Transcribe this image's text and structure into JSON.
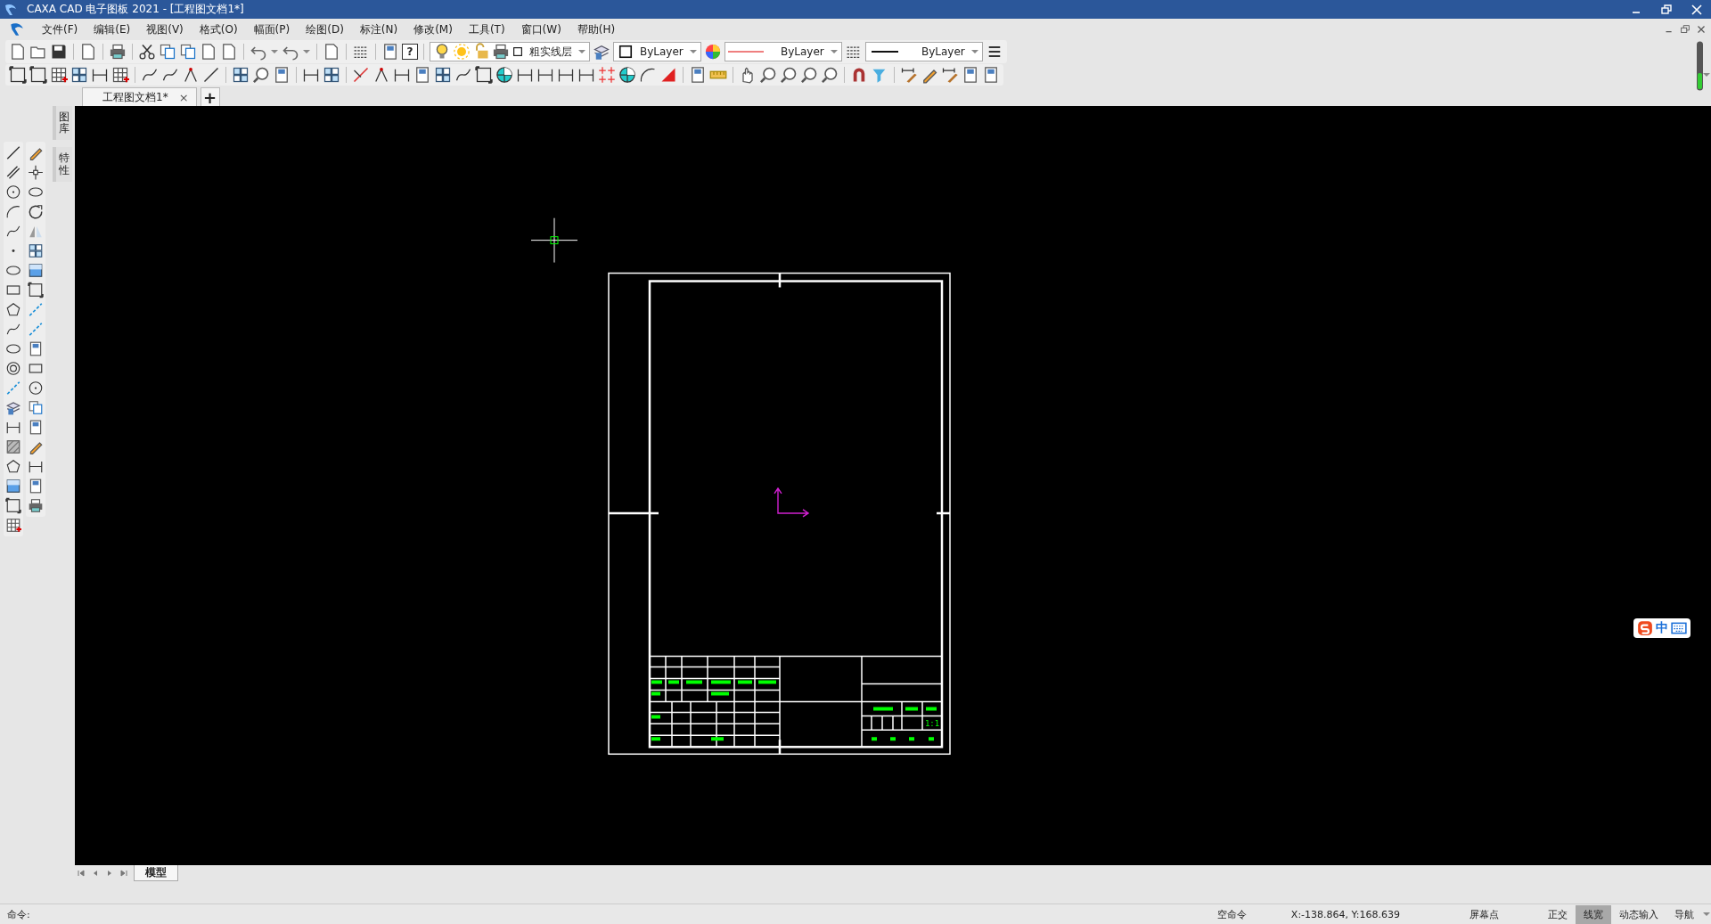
{
  "window": {
    "title": "CAXA CAD 电子图板 2021 - [工程图文档1*]"
  },
  "menu": [
    "文件(F)",
    "编辑(E)",
    "视图(V)",
    "格式(O)",
    "幅面(P)",
    "绘图(D)",
    "标注(N)",
    "修改(M)",
    "工具(T)",
    "窗口(W)",
    "帮助(H)"
  ],
  "toolbar": {
    "help_glyph": "?",
    "layer": "粗实线层",
    "color_mode": "ByLayer",
    "linetype": "ByLayer",
    "lineweight": "ByLayer"
  },
  "document_tabs": [
    {
      "label": "工程图文档1*",
      "selected": true,
      "close": "×"
    }
  ],
  "new_tab": "+",
  "side_panels": [
    "图库",
    "特性"
  ],
  "title_block": {
    "scale": "1:1"
  },
  "ime": {
    "label": "中"
  },
  "sheet_tabs": [
    {
      "label": "模型",
      "selected": true
    }
  ],
  "status_bar": {
    "prompt": "命令:",
    "command": "空命令",
    "coordinates": "X:-138.864, Y:168.639",
    "point_mode": "屏幕点",
    "toggles": [
      {
        "label": "正交",
        "selected": false
      },
      {
        "label": "线宽",
        "selected": true
      },
      {
        "label": "动态输入",
        "selected": false
      },
      {
        "label": "导航",
        "selected": false
      }
    ]
  }
}
